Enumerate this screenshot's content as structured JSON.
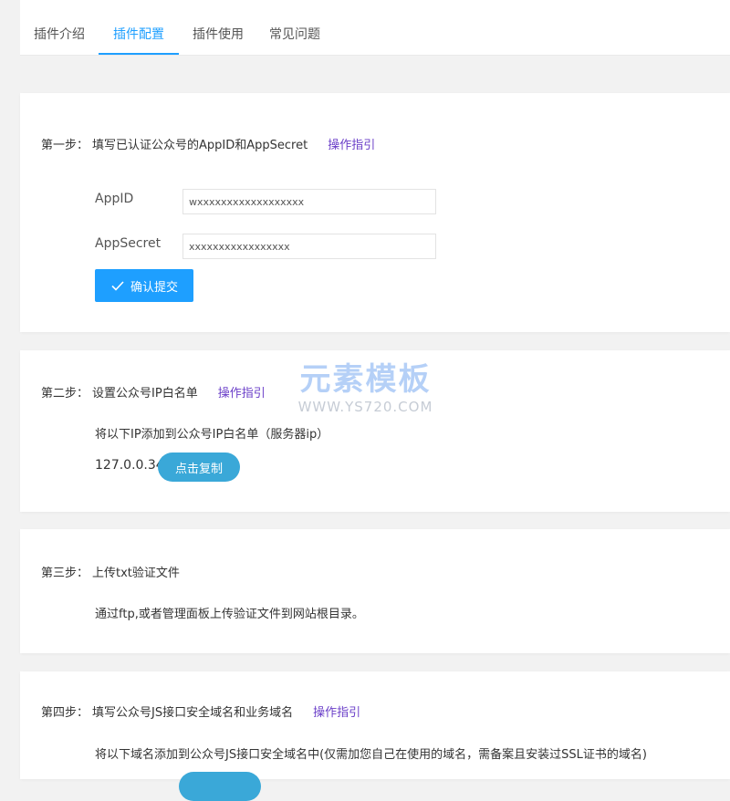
{
  "tabs": [
    {
      "label": "插件介绍"
    },
    {
      "label": "插件配置"
    },
    {
      "label": "插件使用"
    },
    {
      "label": "常见问题"
    }
  ],
  "step1": {
    "label": "第一步：",
    "text": "填写已认证公众号的AppID和AppSecret",
    "guide": "操作指引",
    "appid_label": "AppID",
    "appid_value": "wxxxxxxxxxxxxxxxxxx",
    "appsecret_label": "AppSecret",
    "appsecret_value": "xxxxxxxxxxxxxxxxx",
    "submit_label": "确认提交"
  },
  "step2": {
    "label": "第二步：",
    "text": "设置公众号IP白名单",
    "guide": "操作指引",
    "desc": "将以下IP添加到公众号IP白名单（服务器ip）",
    "ip": "127.0.0.34",
    "copy_label": "点击复制"
  },
  "step3": {
    "label": "第三步：",
    "text": "上传txt验证文件",
    "desc": "通过ftp,或者管理面板上传验证文件到网站根目录。"
  },
  "step4": {
    "label": "第四步：",
    "text": "填写公众号JS接口安全域名和业务域名",
    "guide": "操作指引",
    "desc": "将以下域名添加到公众号JS接口安全域名中(仅需加您自己在使用的域名，需备案且安装过SSL证书的域名)"
  },
  "watermark": {
    "main": "元素模板",
    "sub": "WWW.YS720.COM"
  },
  "colors": {
    "accent": "#1e9fff",
    "link": "#6a3ec8",
    "copy_button": "#3aa8d8"
  }
}
